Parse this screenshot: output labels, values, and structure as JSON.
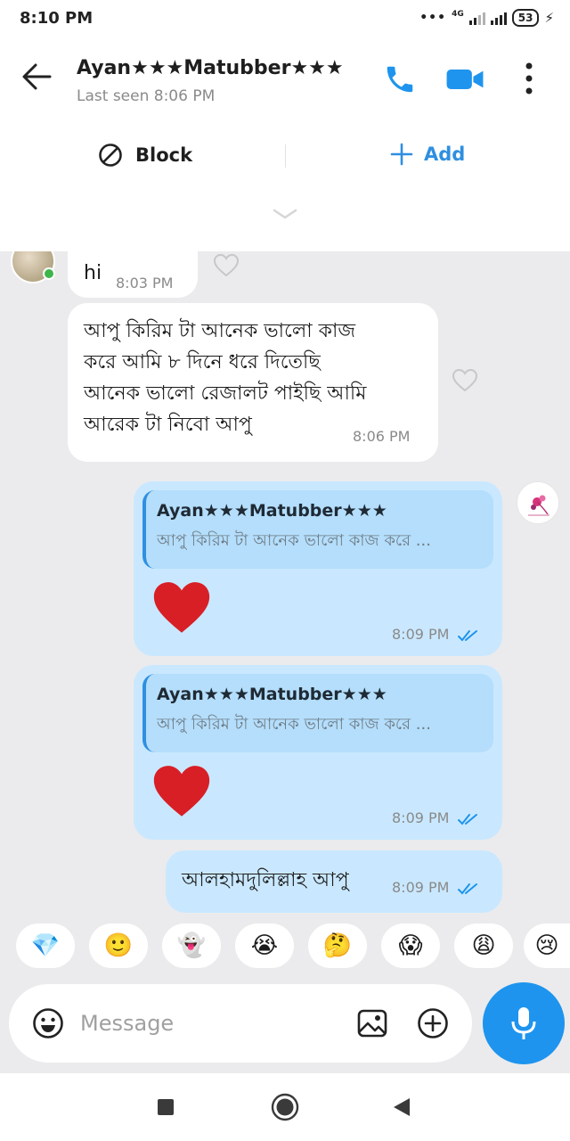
{
  "status_bar": {
    "time": "8:10 PM",
    "network": "4G",
    "battery": "53"
  },
  "header": {
    "contact_name": "Ayan★★★Matubber★★★",
    "last_seen": "Last seen 8:06 PM"
  },
  "actions": {
    "block": "Block",
    "add": "Add"
  },
  "messages": [
    {
      "text": "hi",
      "time": "8:03 PM"
    },
    {
      "lines": [
        "আপু কিরিম টা আনেক ভালো  কাজ",
        "করে আমি ৮  দিনে ধরে দিতেছি",
        "আনেক ভালো রেজালট পাইছি আমি",
        "আরেক টা নিবো  আপু"
      ],
      "time": "8:06 PM"
    },
    {
      "reply_name": "Ayan★★★Matubber★★★",
      "reply_text": "আপু কিরিম টা আনেক ভালো  কাজ করে ...",
      "emoji": "❤️",
      "time": "8:09 PM"
    },
    {
      "reply_name": "Ayan★★★Matubber★★★",
      "reply_text": "আপু কিরিম টা আনেক ভালো  কাজ করে ...",
      "emoji": "❤️",
      "time": "8:09 PM"
    },
    {
      "text": "আলহামদুলিল্লাহ আপু",
      "time": "8:09 PM"
    }
  ],
  "emoji_suggestions": [
    "💎",
    "🙂",
    "👻",
    "😭",
    "🤔",
    "😱",
    "😩",
    "😢"
  ],
  "composer": {
    "placeholder": "Message"
  },
  "colors": {
    "accent": "#1e94ee",
    "outgoing_bubble": "#c9e8ff",
    "chat_background": "#ebebed"
  }
}
